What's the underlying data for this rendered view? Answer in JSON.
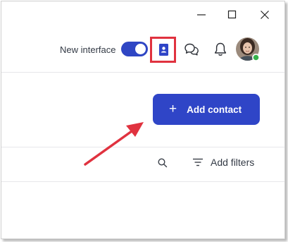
{
  "window": {
    "controls": [
      "minimize-icon",
      "maximize-icon",
      "close-icon"
    ]
  },
  "header": {
    "new_interface_label": "New interface",
    "new_interface_enabled": true,
    "icons": [
      "contacts-book-icon",
      "chat-icon",
      "bell-icon"
    ],
    "avatar_status": "online",
    "highlight_color": "#e0323f"
  },
  "toolbar": {
    "add_contact_label": "Add contact",
    "add_contact_icon": "plus-icon",
    "search_icon": "search-icon",
    "filter_icon": "filter-icon",
    "add_filters_label": "Add filters"
  },
  "colors": {
    "accent": "#2f45c7",
    "annotation": "#e0323f",
    "status_online": "#36b24a"
  }
}
